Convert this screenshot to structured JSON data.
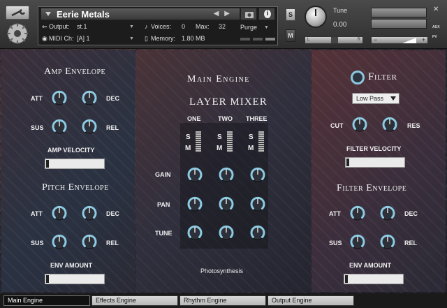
{
  "header": {
    "instrument_name": "Eerie Metals",
    "output_label": "Output:",
    "output_value": "st.1",
    "voices_label": "Voices:",
    "voices_value": "0",
    "max_label": "Max:",
    "max_value": "32",
    "purge_label": "Purge",
    "midi_label": "MIDI Ch:",
    "midi_value": "[A]  1",
    "memory_label": "Memory:",
    "memory_value": "1.80 MB",
    "solo_label": "S",
    "mute_label": "M",
    "tune_label": "Tune",
    "tune_value": "0.00",
    "pan_left": "L",
    "pan_right": "R",
    "aux_label": "AUX",
    "pv_label": "PV",
    "minus": "−",
    "plus": "+"
  },
  "amp": {
    "title": "Amp Envelope",
    "att": "ATT",
    "dec": "DEC",
    "sus": "SUS",
    "rel": "REL",
    "velocity_label": "AMP VELOCITY"
  },
  "pitch": {
    "title": "Pitch Envelope",
    "att": "ATT",
    "dec": "DEC",
    "sus": "SUS",
    "rel": "REL",
    "env_amount_label": "ENV AMOUNT"
  },
  "main_engine": {
    "title": "Main Engine",
    "mixer_title": "LAYER MIXER",
    "columns": [
      "ONE",
      "TWO",
      "THREE"
    ],
    "solo": "S",
    "mute": "M",
    "rows": [
      "GAIN",
      "PAN",
      "TUNE"
    ],
    "footer": "Photosynthesis"
  },
  "filter": {
    "title": "Filter",
    "type": "Low Pass",
    "cut": "CUT",
    "res": "RES",
    "velocity_label": "FILTER VELOCITY"
  },
  "filter_env": {
    "title": "Filter Envelope",
    "att": "ATT",
    "dec": "DEC",
    "sus": "SUS",
    "rel": "REL",
    "env_amount_label": "ENV AMOUNT"
  },
  "tabs": [
    "Main Engine",
    "Effects Engine",
    "Rhythm Engine",
    "Output Engine"
  ],
  "colors": {
    "knob_arc": "#8ccbe3",
    "knob_body": "#2d3038"
  }
}
